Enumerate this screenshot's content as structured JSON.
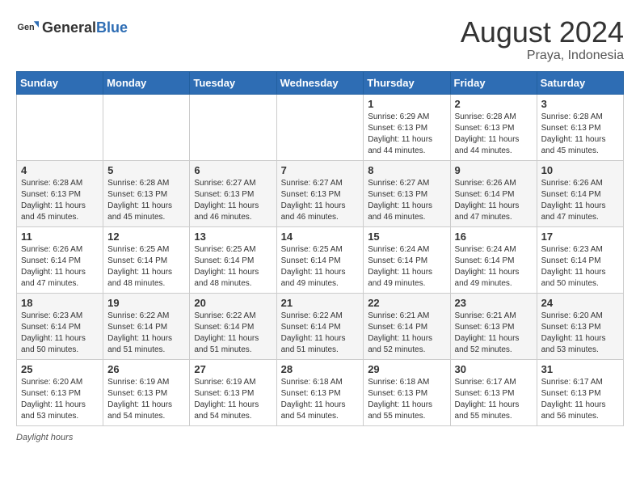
{
  "header": {
    "logo_general": "General",
    "logo_blue": "Blue",
    "month_year": "August 2024",
    "location": "Praya, Indonesia"
  },
  "footer": {
    "daylight_label": "Daylight hours"
  },
  "weekdays": [
    "Sunday",
    "Monday",
    "Tuesday",
    "Wednesday",
    "Thursday",
    "Friday",
    "Saturday"
  ],
  "weeks": [
    [
      {
        "day": "",
        "info": ""
      },
      {
        "day": "",
        "info": ""
      },
      {
        "day": "",
        "info": ""
      },
      {
        "day": "",
        "info": ""
      },
      {
        "day": "1",
        "info": "Sunrise: 6:29 AM\nSunset: 6:13 PM\nDaylight: 11 hours and 44 minutes."
      },
      {
        "day": "2",
        "info": "Sunrise: 6:28 AM\nSunset: 6:13 PM\nDaylight: 11 hours and 44 minutes."
      },
      {
        "day": "3",
        "info": "Sunrise: 6:28 AM\nSunset: 6:13 PM\nDaylight: 11 hours and 45 minutes."
      }
    ],
    [
      {
        "day": "4",
        "info": "Sunrise: 6:28 AM\nSunset: 6:13 PM\nDaylight: 11 hours and 45 minutes."
      },
      {
        "day": "5",
        "info": "Sunrise: 6:28 AM\nSunset: 6:13 PM\nDaylight: 11 hours and 45 minutes."
      },
      {
        "day": "6",
        "info": "Sunrise: 6:27 AM\nSunset: 6:13 PM\nDaylight: 11 hours and 46 minutes."
      },
      {
        "day": "7",
        "info": "Sunrise: 6:27 AM\nSunset: 6:13 PM\nDaylight: 11 hours and 46 minutes."
      },
      {
        "day": "8",
        "info": "Sunrise: 6:27 AM\nSunset: 6:13 PM\nDaylight: 11 hours and 46 minutes."
      },
      {
        "day": "9",
        "info": "Sunrise: 6:26 AM\nSunset: 6:14 PM\nDaylight: 11 hours and 47 minutes."
      },
      {
        "day": "10",
        "info": "Sunrise: 6:26 AM\nSunset: 6:14 PM\nDaylight: 11 hours and 47 minutes."
      }
    ],
    [
      {
        "day": "11",
        "info": "Sunrise: 6:26 AM\nSunset: 6:14 PM\nDaylight: 11 hours and 47 minutes."
      },
      {
        "day": "12",
        "info": "Sunrise: 6:25 AM\nSunset: 6:14 PM\nDaylight: 11 hours and 48 minutes."
      },
      {
        "day": "13",
        "info": "Sunrise: 6:25 AM\nSunset: 6:14 PM\nDaylight: 11 hours and 48 minutes."
      },
      {
        "day": "14",
        "info": "Sunrise: 6:25 AM\nSunset: 6:14 PM\nDaylight: 11 hours and 49 minutes."
      },
      {
        "day": "15",
        "info": "Sunrise: 6:24 AM\nSunset: 6:14 PM\nDaylight: 11 hours and 49 minutes."
      },
      {
        "day": "16",
        "info": "Sunrise: 6:24 AM\nSunset: 6:14 PM\nDaylight: 11 hours and 49 minutes."
      },
      {
        "day": "17",
        "info": "Sunrise: 6:23 AM\nSunset: 6:14 PM\nDaylight: 11 hours and 50 minutes."
      }
    ],
    [
      {
        "day": "18",
        "info": "Sunrise: 6:23 AM\nSunset: 6:14 PM\nDaylight: 11 hours and 50 minutes."
      },
      {
        "day": "19",
        "info": "Sunrise: 6:22 AM\nSunset: 6:14 PM\nDaylight: 11 hours and 51 minutes."
      },
      {
        "day": "20",
        "info": "Sunrise: 6:22 AM\nSunset: 6:14 PM\nDaylight: 11 hours and 51 minutes."
      },
      {
        "day": "21",
        "info": "Sunrise: 6:22 AM\nSunset: 6:14 PM\nDaylight: 11 hours and 51 minutes."
      },
      {
        "day": "22",
        "info": "Sunrise: 6:21 AM\nSunset: 6:14 PM\nDaylight: 11 hours and 52 minutes."
      },
      {
        "day": "23",
        "info": "Sunrise: 6:21 AM\nSunset: 6:13 PM\nDaylight: 11 hours and 52 minutes."
      },
      {
        "day": "24",
        "info": "Sunrise: 6:20 AM\nSunset: 6:13 PM\nDaylight: 11 hours and 53 minutes."
      }
    ],
    [
      {
        "day": "25",
        "info": "Sunrise: 6:20 AM\nSunset: 6:13 PM\nDaylight: 11 hours and 53 minutes."
      },
      {
        "day": "26",
        "info": "Sunrise: 6:19 AM\nSunset: 6:13 PM\nDaylight: 11 hours and 54 minutes."
      },
      {
        "day": "27",
        "info": "Sunrise: 6:19 AM\nSunset: 6:13 PM\nDaylight: 11 hours and 54 minutes."
      },
      {
        "day": "28",
        "info": "Sunrise: 6:18 AM\nSunset: 6:13 PM\nDaylight: 11 hours and 54 minutes."
      },
      {
        "day": "29",
        "info": "Sunrise: 6:18 AM\nSunset: 6:13 PM\nDaylight: 11 hours and 55 minutes."
      },
      {
        "day": "30",
        "info": "Sunrise: 6:17 AM\nSunset: 6:13 PM\nDaylight: 11 hours and 55 minutes."
      },
      {
        "day": "31",
        "info": "Sunrise: 6:17 AM\nSunset: 6:13 PM\nDaylight: 11 hours and 56 minutes."
      }
    ]
  ]
}
